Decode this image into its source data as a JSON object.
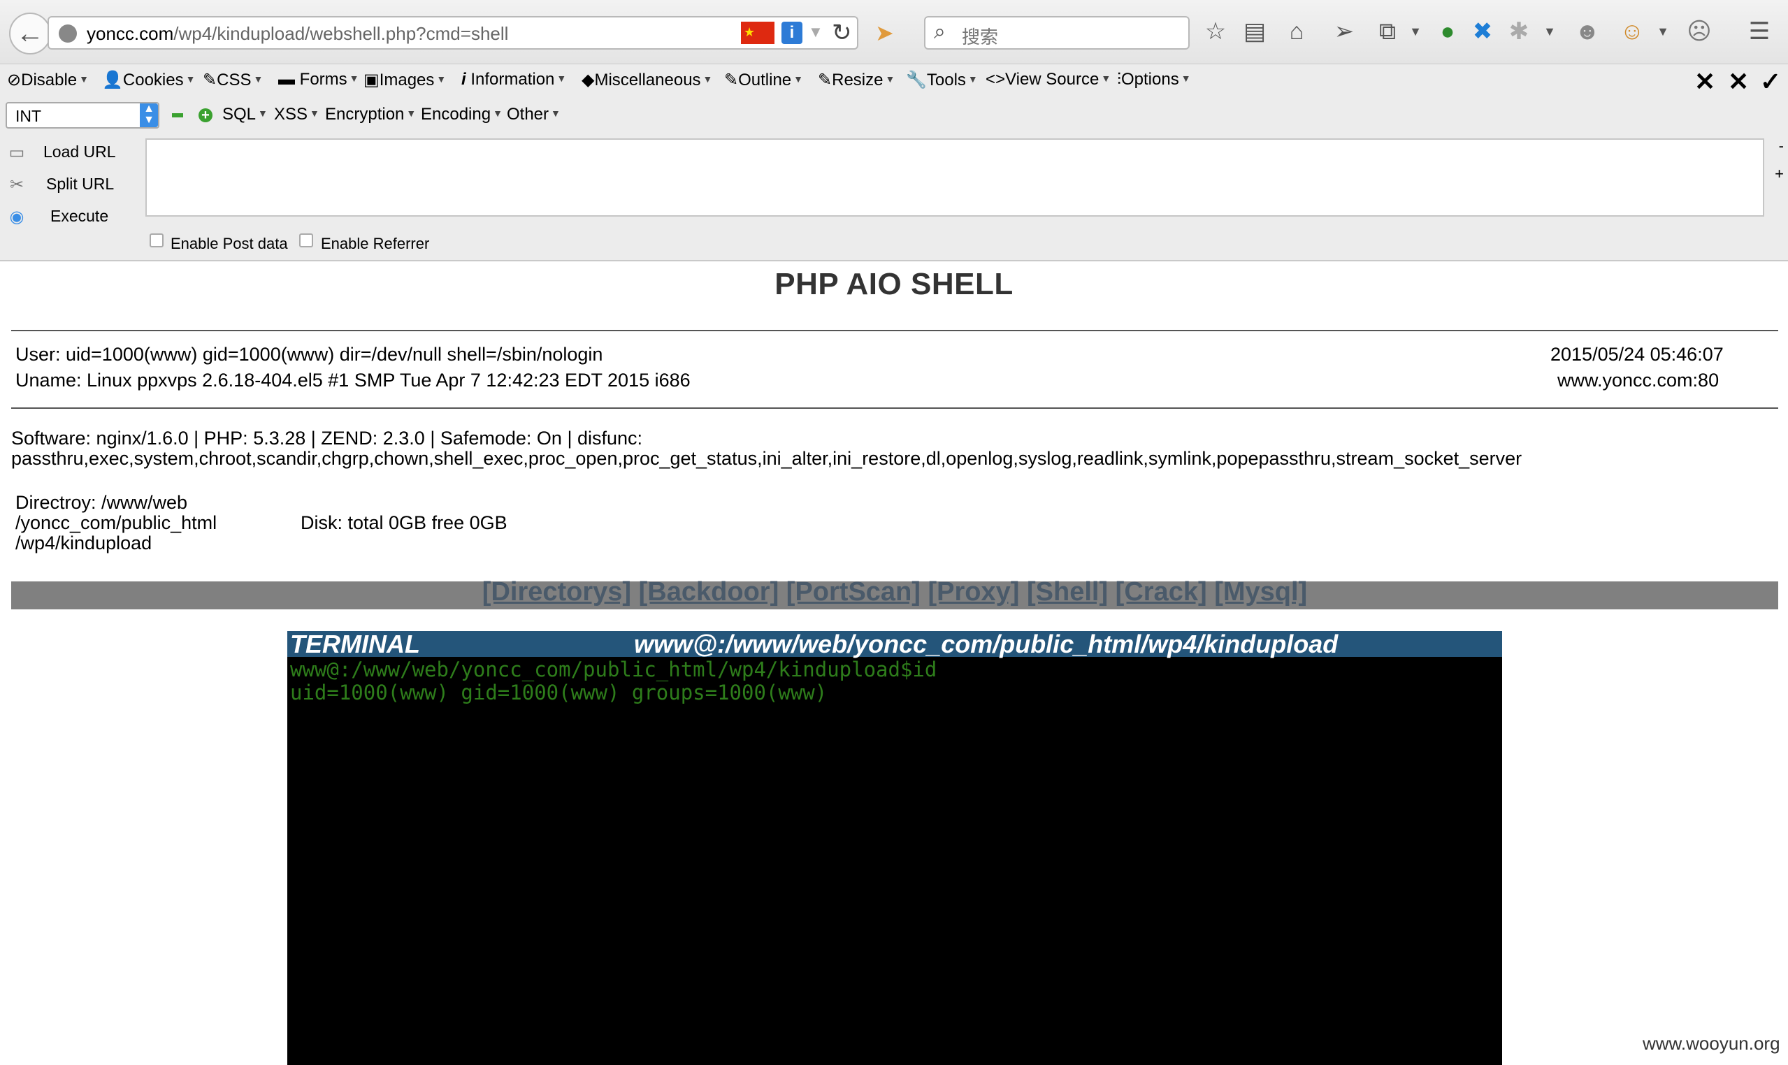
{
  "browser": {
    "url_host": "yoncc.com",
    "url_path": "/wp4/kindupload/webshell.php?cmd=shell",
    "search_placeholder": "搜索"
  },
  "hackbar": {
    "menu": [
      "Disable",
      "Cookies",
      "CSS",
      "Forms",
      "Images",
      "Information",
      "Miscellaneous",
      "Outline",
      "Resize",
      "Tools",
      "View Source",
      "Options"
    ],
    "select_value": "INT",
    "menu2": [
      "SQL",
      "XSS",
      "Encryption",
      "Encoding",
      "Other"
    ],
    "load_url": "Load URL",
    "split_url": "Split URL",
    "execute": "Execute",
    "enable_post": "Enable Post data",
    "enable_referrer": "Enable Referrer",
    "minus_label": "-",
    "plus_label": "+"
  },
  "shell": {
    "title": "PHP AIO SHELL",
    "user_line": "User: uid=1000(www) gid=1000(www) dir=/dev/null shell=/sbin/nologin",
    "uname_line": "Uname: Linux ppxvps 2.6.18-404.el5 #1 SMP Tue Apr 7 12:42:23 EDT 2015 i686",
    "datetime": "2015/05/24 05:46:07",
    "host": "www.yoncc.com:80",
    "software_line": "Software: nginx/1.6.0 | PHP: 5.3.28 | ZEND: 2.3.0 | Safemode: On | disfunc:",
    "disfunc_line": "passthru,exec,system,chroot,scandir,chgrp,chown,shell_exec,proc_open,proc_get_status,ini_alter,ini_restore,dl,openlog,syslog,readlink,symlink,popepassthru,stream_socket_server",
    "dir_line1": "Directroy: /www/web",
    "dir_line2": "/yoncc_com/public_html",
    "dir_line3": "/wp4/kindupload",
    "disk": "Disk: total 0GB free 0GB",
    "nav": [
      "[Directorys]",
      "[Backdoor]",
      "[PortScan]",
      "[Proxy]",
      "[Shell]",
      "[Crack]",
      "[Mysql]"
    ]
  },
  "terminal": {
    "label": "TERMINAL",
    "path": "www@:/www/web/yoncc_com/public_html/wp4/kindupload",
    "lines": [
      "www@:/www/web/yoncc_com/public_html/wp4/kindupload$id",
      "uid=1000(www) gid=1000(www) groups=1000(www)"
    ]
  },
  "watermark": "www.wooyun.org"
}
